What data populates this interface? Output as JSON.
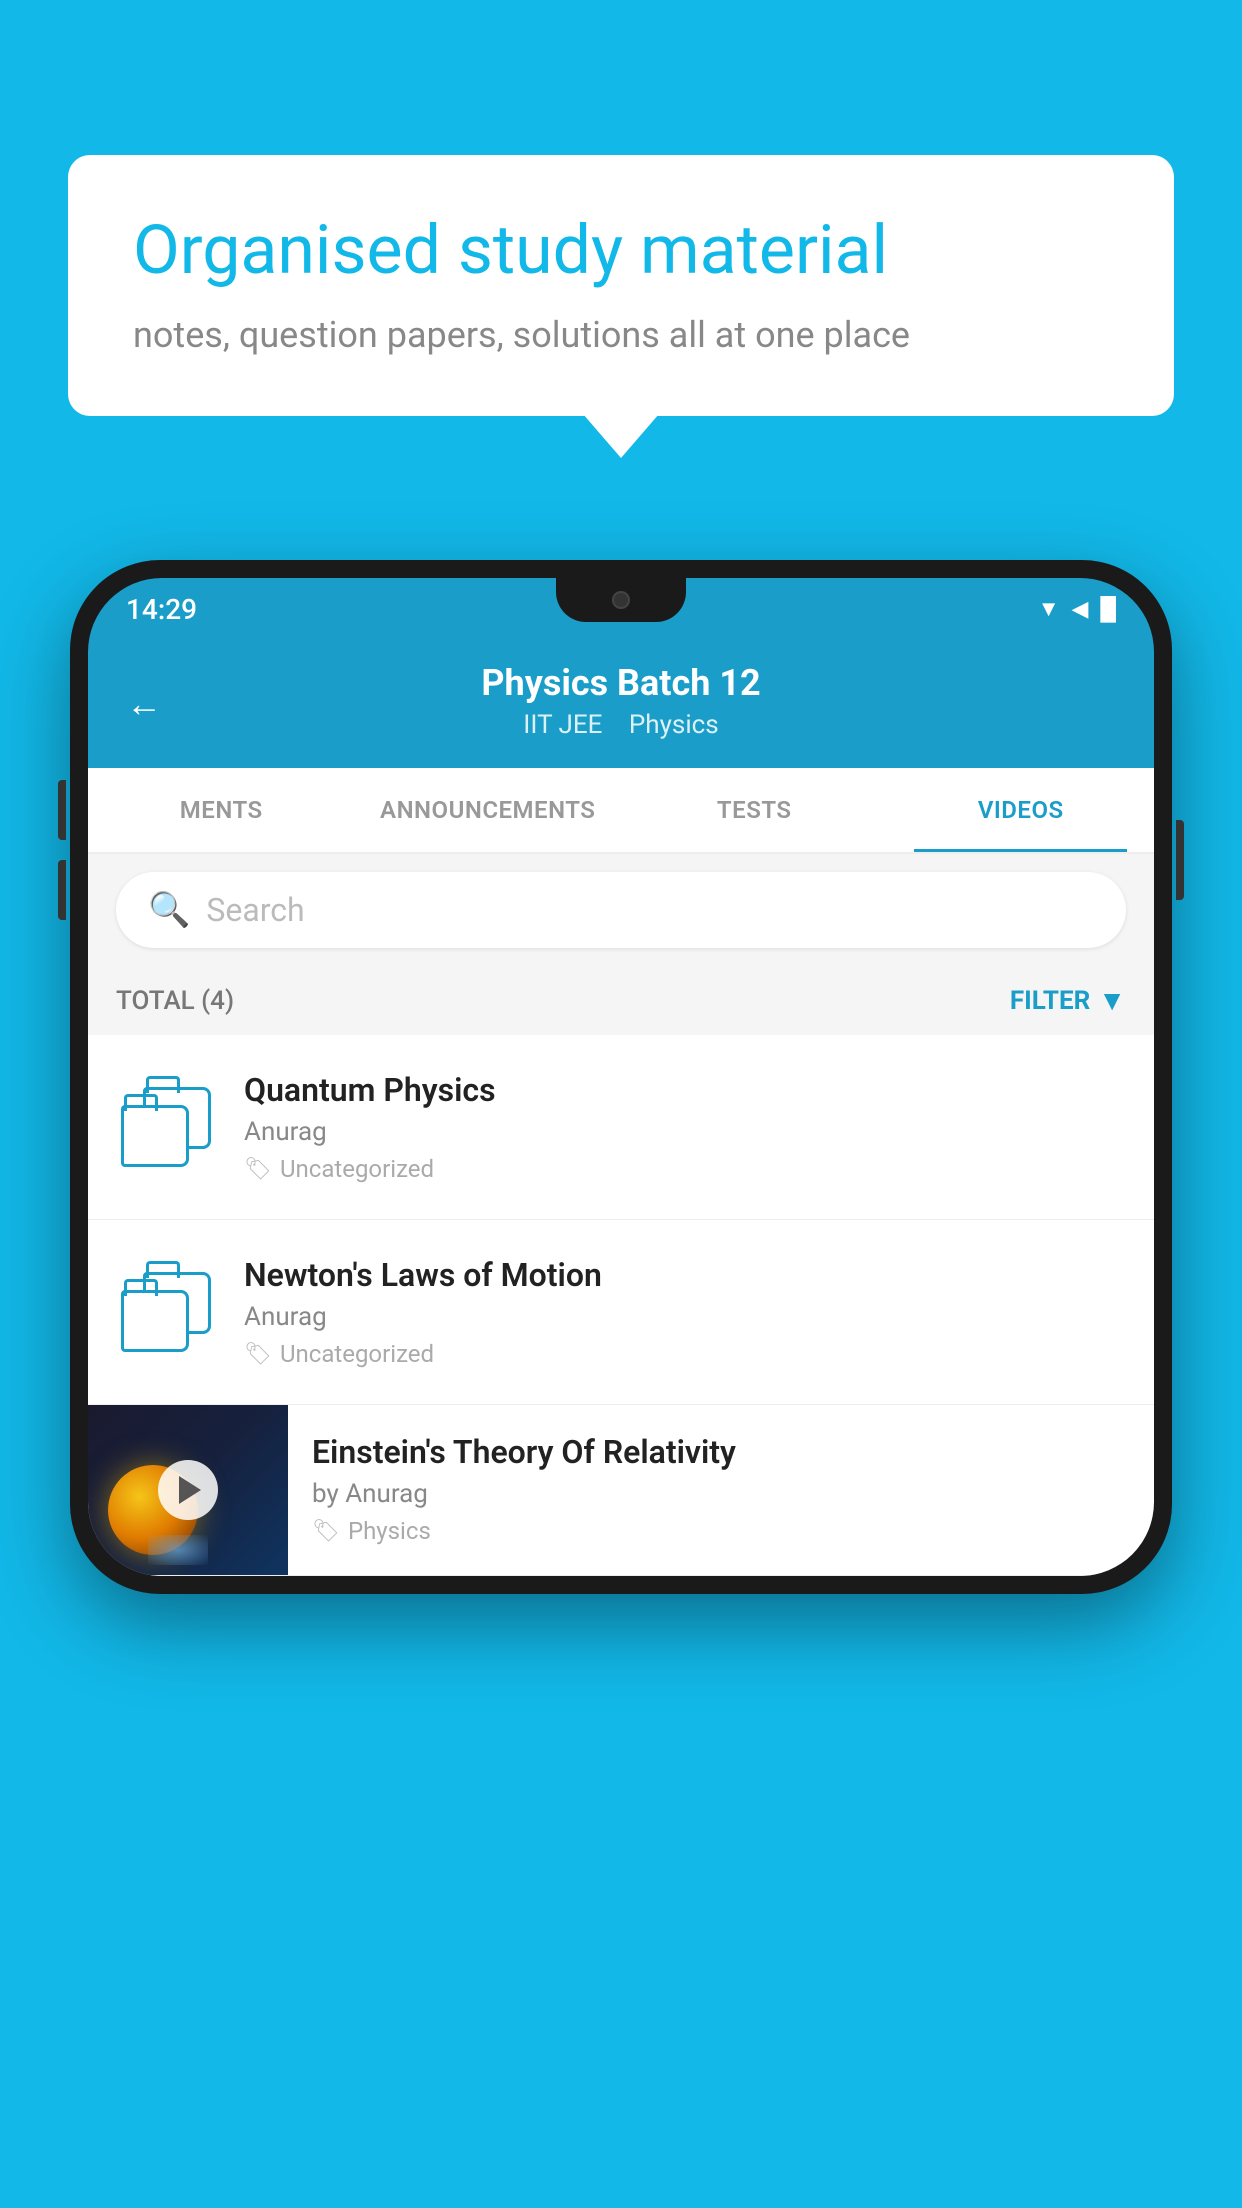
{
  "background_color": "#12B8E8",
  "bubble": {
    "title": "Organised study material",
    "subtitle": "notes, question papers, solutions all at one place"
  },
  "phone": {
    "status_bar": {
      "time": "14:29",
      "icons": "▼◀█"
    },
    "header": {
      "title": "Physics Batch 12",
      "subtitle_parts": [
        "IIT JEE",
        "Physics"
      ],
      "back_label": "←"
    },
    "tabs": [
      {
        "label": "MENTS",
        "active": false
      },
      {
        "label": "ANNOUNCEMENTS",
        "active": false
      },
      {
        "label": "TESTS",
        "active": false
      },
      {
        "label": "VIDEOS",
        "active": true
      }
    ],
    "search": {
      "placeholder": "Search"
    },
    "filter_bar": {
      "total_label": "TOTAL (4)",
      "filter_label": "FILTER"
    },
    "videos": [
      {
        "title": "Quantum Physics",
        "author": "Anurag",
        "tag": "Uncategorized",
        "has_thumb": false
      },
      {
        "title": "Newton's Laws of Motion",
        "author": "Anurag",
        "tag": "Uncategorized",
        "has_thumb": false
      },
      {
        "title": "Einstein's Theory Of Relativity",
        "author": "by Anurag",
        "tag": "Physics",
        "has_thumb": true
      }
    ]
  }
}
